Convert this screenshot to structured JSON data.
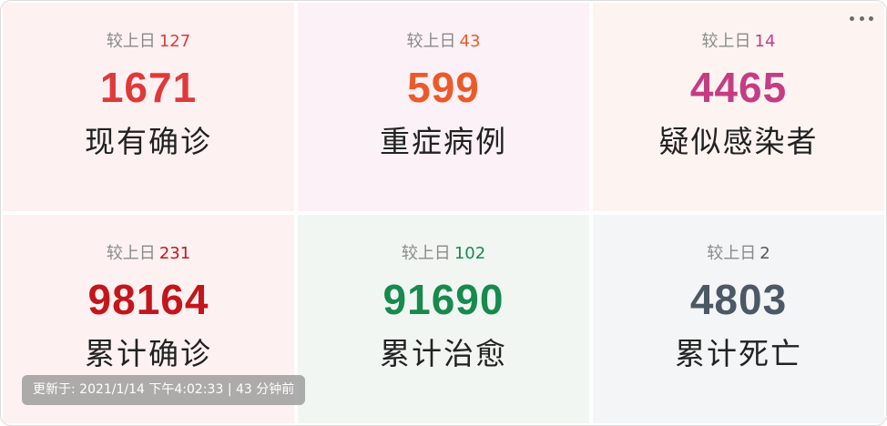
{
  "stats": [
    {
      "delta_label": "较上日",
      "delta_value": "127",
      "value": "1671",
      "label": "现有确诊",
      "bg": "#fdf1f1",
      "value_color": "#e0393b",
      "delta_color": "#e0393b"
    },
    {
      "delta_label": "较上日",
      "delta_value": "43",
      "value": "599",
      "label": "重症病例",
      "bg": "#fcf1f6",
      "value_color": "#ec5a2a",
      "delta_color": "#ec5a2a"
    },
    {
      "delta_label": "较上日",
      "delta_value": "14",
      "value": "4465",
      "label": "疑似感染者",
      "bg": "#fdf4f1",
      "value_color": "#c43d84",
      "delta_color": "#c43d84"
    },
    {
      "delta_label": "较上日",
      "delta_value": "231",
      "value": "98164",
      "label": "累计确诊",
      "bg": "#fdf1f1",
      "value_color": "#c3161c",
      "delta_color": "#c3161c"
    },
    {
      "delta_label": "较上日",
      "delta_value": "102",
      "value": "91690",
      "label": "累计治愈",
      "bg": "#f1f6f3",
      "value_color": "#178a4d",
      "delta_color": "#178a4d"
    },
    {
      "delta_label": "较上日",
      "delta_value": "2",
      "value": "4803",
      "label": "累计死亡",
      "bg": "#f3f5f6",
      "value_color": "#4d5866",
      "delta_color": "#555555"
    }
  ],
  "menu_icon": "more-horizontal-icon",
  "update_note": "更新于: 2021/1/14 下午4:02:33 | 43 分钟前"
}
